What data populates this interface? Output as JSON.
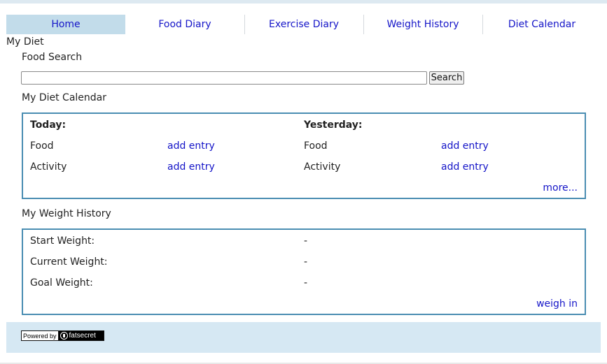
{
  "nav": {
    "tabs": [
      {
        "label": "Home",
        "active": true
      },
      {
        "label": "Food Diary",
        "active": false
      },
      {
        "label": "Exercise Diary",
        "active": false
      },
      {
        "label": "Weight History",
        "active": false
      },
      {
        "label": "Diet Calendar",
        "active": false
      }
    ]
  },
  "page": {
    "title": "My Diet"
  },
  "food_search": {
    "heading": "Food Search",
    "value": "",
    "button_label": "Search"
  },
  "diet_calendar": {
    "heading": "My Diet Calendar",
    "today": {
      "label": "Today:",
      "rows": [
        {
          "label": "Food",
          "action": "add entry"
        },
        {
          "label": "Activity",
          "action": "add entry"
        }
      ]
    },
    "yesterday": {
      "label": "Yesterday:",
      "rows": [
        {
          "label": "Food",
          "action": "add entry"
        },
        {
          "label": "Activity",
          "action": "add entry"
        }
      ]
    },
    "more_link": "more..."
  },
  "weight_history": {
    "heading": "My Weight History",
    "rows": [
      {
        "label": "Start Weight:",
        "value": "-"
      },
      {
        "label": "Current Weight:",
        "value": "-"
      },
      {
        "label": "Goal Weight:",
        "value": "-"
      }
    ],
    "weigh_in_link": "weigh in"
  },
  "footer": {
    "badge_left": "Powered by",
    "badge_right": "fatsecret"
  },
  "colors": {
    "link": "#1515c8",
    "active_tab": "#c2dcea",
    "box_border": "#4a8db2",
    "footer_bg": "#d6e8f3"
  }
}
